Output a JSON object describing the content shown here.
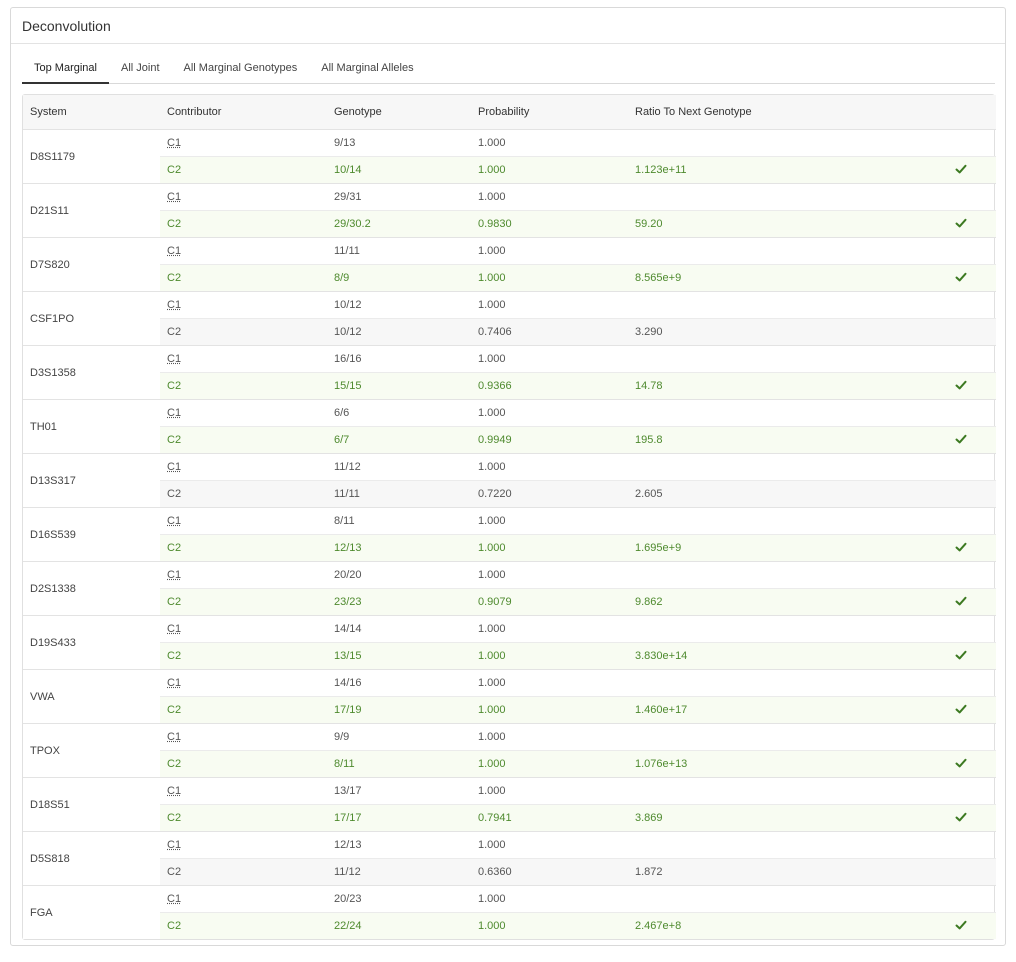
{
  "panel": {
    "title": "Deconvolution"
  },
  "tabs": [
    "Top Marginal",
    "All Joint",
    "All Marginal Genotypes",
    "All Marginal Alleles"
  ],
  "table": {
    "headers": [
      "System",
      "Contributor",
      "Genotype",
      "Probability",
      "Ratio To Next Genotype",
      ""
    ],
    "systems": [
      {
        "system": "D8S1179",
        "rows": [
          {
            "contributor": "C1",
            "genotype": "9/13",
            "probability": "1.000",
            "ratio": "",
            "pass": false
          },
          {
            "contributor": "C2",
            "genotype": "10/14",
            "probability": "1.000",
            "ratio": "1.123e+11",
            "pass": true
          }
        ]
      },
      {
        "system": "D21S11",
        "rows": [
          {
            "contributor": "C1",
            "genotype": "29/31",
            "probability": "1.000",
            "ratio": "",
            "pass": false
          },
          {
            "contributor": "C2",
            "genotype": "29/30.2",
            "probability": "0.9830",
            "ratio": "59.20",
            "pass": true
          }
        ]
      },
      {
        "system": "D7S820",
        "rows": [
          {
            "contributor": "C1",
            "genotype": "11/11",
            "probability": "1.000",
            "ratio": "",
            "pass": false
          },
          {
            "contributor": "C2",
            "genotype": "8/9",
            "probability": "1.000",
            "ratio": "8.565e+9",
            "pass": true
          }
        ]
      },
      {
        "system": "CSF1PO",
        "rows": [
          {
            "contributor": "C1",
            "genotype": "10/12",
            "probability": "1.000",
            "ratio": "",
            "pass": false
          },
          {
            "contributor": "C2",
            "genotype": "10/12",
            "probability": "0.7406",
            "ratio": "3.290",
            "pass": false
          }
        ]
      },
      {
        "system": "D3S1358",
        "rows": [
          {
            "contributor": "C1",
            "genotype": "16/16",
            "probability": "1.000",
            "ratio": "",
            "pass": false
          },
          {
            "contributor": "C2",
            "genotype": "15/15",
            "probability": "0.9366",
            "ratio": "14.78",
            "pass": true
          }
        ]
      },
      {
        "system": "TH01",
        "rows": [
          {
            "contributor": "C1",
            "genotype": "6/6",
            "probability": "1.000",
            "ratio": "",
            "pass": false
          },
          {
            "contributor": "C2",
            "genotype": "6/7",
            "probability": "0.9949",
            "ratio": "195.8",
            "pass": true
          }
        ]
      },
      {
        "system": "D13S317",
        "rows": [
          {
            "contributor": "C1",
            "genotype": "11/12",
            "probability": "1.000",
            "ratio": "",
            "pass": false
          },
          {
            "contributor": "C2",
            "genotype": "11/11",
            "probability": "0.7220",
            "ratio": "2.605",
            "pass": false
          }
        ]
      },
      {
        "system": "D16S539",
        "rows": [
          {
            "contributor": "C1",
            "genotype": "8/11",
            "probability": "1.000",
            "ratio": "",
            "pass": false
          },
          {
            "contributor": "C2",
            "genotype": "12/13",
            "probability": "1.000",
            "ratio": "1.695e+9",
            "pass": true
          }
        ]
      },
      {
        "system": "D2S1338",
        "rows": [
          {
            "contributor": "C1",
            "genotype": "20/20",
            "probability": "1.000",
            "ratio": "",
            "pass": false
          },
          {
            "contributor": "C2",
            "genotype": "23/23",
            "probability": "0.9079",
            "ratio": "9.862",
            "pass": true
          }
        ]
      },
      {
        "system": "D19S433",
        "rows": [
          {
            "contributor": "C1",
            "genotype": "14/14",
            "probability": "1.000",
            "ratio": "",
            "pass": false
          },
          {
            "contributor": "C2",
            "genotype": "13/15",
            "probability": "1.000",
            "ratio": "3.830e+14",
            "pass": true
          }
        ]
      },
      {
        "system": "VWA",
        "rows": [
          {
            "contributor": "C1",
            "genotype": "14/16",
            "probability": "1.000",
            "ratio": "",
            "pass": false
          },
          {
            "contributor": "C2",
            "genotype": "17/19",
            "probability": "1.000",
            "ratio": "1.460e+17",
            "pass": true
          }
        ]
      },
      {
        "system": "TPOX",
        "rows": [
          {
            "contributor": "C1",
            "genotype": "9/9",
            "probability": "1.000",
            "ratio": "",
            "pass": false
          },
          {
            "contributor": "C2",
            "genotype": "8/11",
            "probability": "1.000",
            "ratio": "1.076e+13",
            "pass": true
          }
        ]
      },
      {
        "system": "D18S51",
        "rows": [
          {
            "contributor": "C1",
            "genotype": "13/17",
            "probability": "1.000",
            "ratio": "",
            "pass": false
          },
          {
            "contributor": "C2",
            "genotype": "17/17",
            "probability": "0.7941",
            "ratio": "3.869",
            "pass": true
          }
        ]
      },
      {
        "system": "D5S818",
        "rows": [
          {
            "contributor": "C1",
            "genotype": "12/13",
            "probability": "1.000",
            "ratio": "",
            "pass": false
          },
          {
            "contributor": "C2",
            "genotype": "11/12",
            "probability": "0.6360",
            "ratio": "1.872",
            "pass": false
          }
        ]
      },
      {
        "system": "FGA",
        "rows": [
          {
            "contributor": "C1",
            "genotype": "20/23",
            "probability": "1.000",
            "ratio": "",
            "pass": false
          },
          {
            "contributor": "C2",
            "genotype": "22/24",
            "probability": "1.000",
            "ratio": "2.467e+8",
            "pass": true
          }
        ]
      }
    ]
  },
  "colors": {
    "pass_text": "#4e8a2e",
    "pass_bg": "#f8fcf2",
    "check": "#3d7a22"
  }
}
